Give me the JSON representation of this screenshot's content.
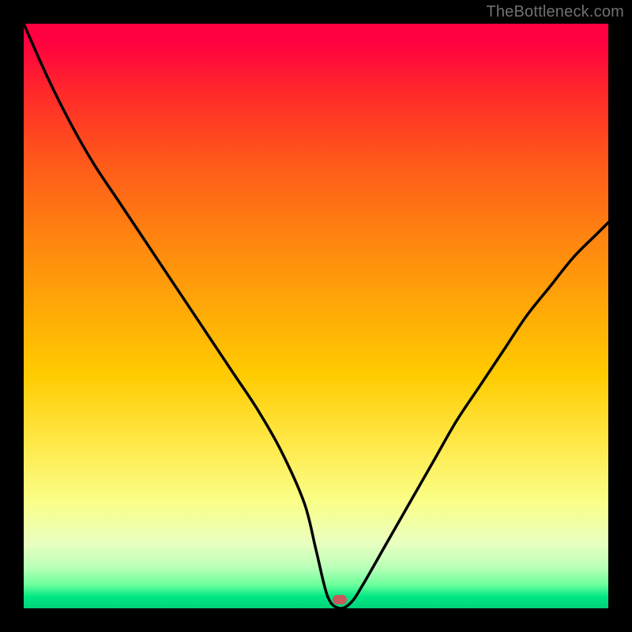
{
  "attribution": "TheBottleneck.com",
  "marker": {
    "x_pct": 54,
    "y_pct": 98.5,
    "color": "#c95a5a"
  },
  "chart_data": {
    "type": "line",
    "title": "",
    "xlabel": "",
    "ylabel": "",
    "x": [
      0,
      4,
      8,
      12,
      16,
      20,
      24,
      28,
      32,
      36,
      40,
      44,
      48,
      50,
      52,
      54,
      56,
      58,
      62,
      66,
      70,
      74,
      78,
      82,
      86,
      90,
      94,
      98,
      100
    ],
    "y": [
      100,
      91,
      83,
      76,
      70,
      64,
      58,
      52,
      46,
      40,
      34,
      27,
      18,
      10,
      2,
      0,
      1,
      4,
      11,
      18,
      25,
      32,
      38,
      44,
      50,
      55,
      60,
      64,
      66
    ],
    "xlim": [
      0,
      100
    ],
    "ylim": [
      0,
      100
    ],
    "annotations": [
      "minimum marker at approximately x=54, y=0"
    ]
  }
}
